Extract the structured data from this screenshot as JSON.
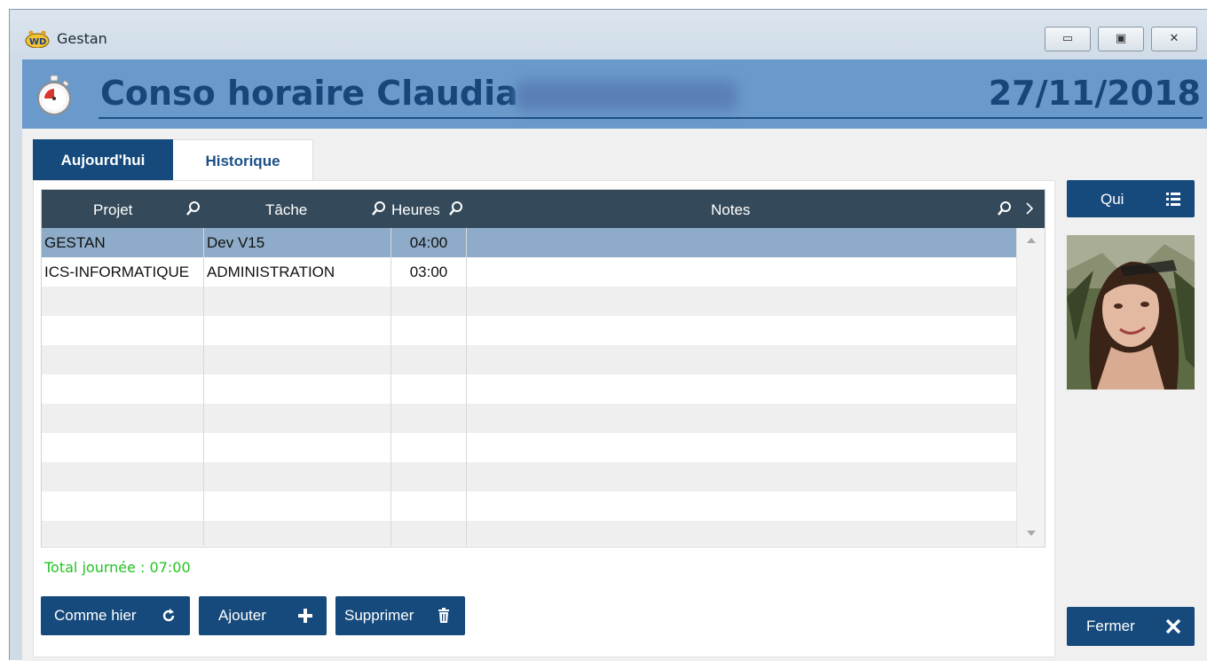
{
  "window": {
    "app_title": "Gestan",
    "controls": [
      "minimize",
      "maximize",
      "close"
    ]
  },
  "header": {
    "title": "Conso horaire  Claudia",
    "date": "27/11/2018"
  },
  "tabs": [
    {
      "label": "Aujourd'hui",
      "active": true
    },
    {
      "label": "Historique",
      "active": false
    }
  ],
  "grid": {
    "columns": [
      "Projet",
      "Tâche",
      "Heures",
      "Notes"
    ],
    "rows": [
      {
        "projet": "GESTAN",
        "tache": "Dev V15",
        "heures": "04:00",
        "notes": ""
      },
      {
        "projet": "ICS-INFORMATIQUE",
        "tache": "ADMINISTRATION",
        "heures": "03:00",
        "notes": ""
      }
    ]
  },
  "total": "Total journée :  07:00",
  "buttons": {
    "comme_hier": "Comme hier",
    "ajouter": "Ajouter",
    "supprimer": "Supprimer",
    "qui": "Qui",
    "fermer": "Fermer"
  },
  "colors": {
    "header_band": "#6a9acb",
    "dark_blue": "#164a7c",
    "grid_header": "#344a5a",
    "selected_row": "#8eacc9",
    "total_green": "#22c422"
  }
}
